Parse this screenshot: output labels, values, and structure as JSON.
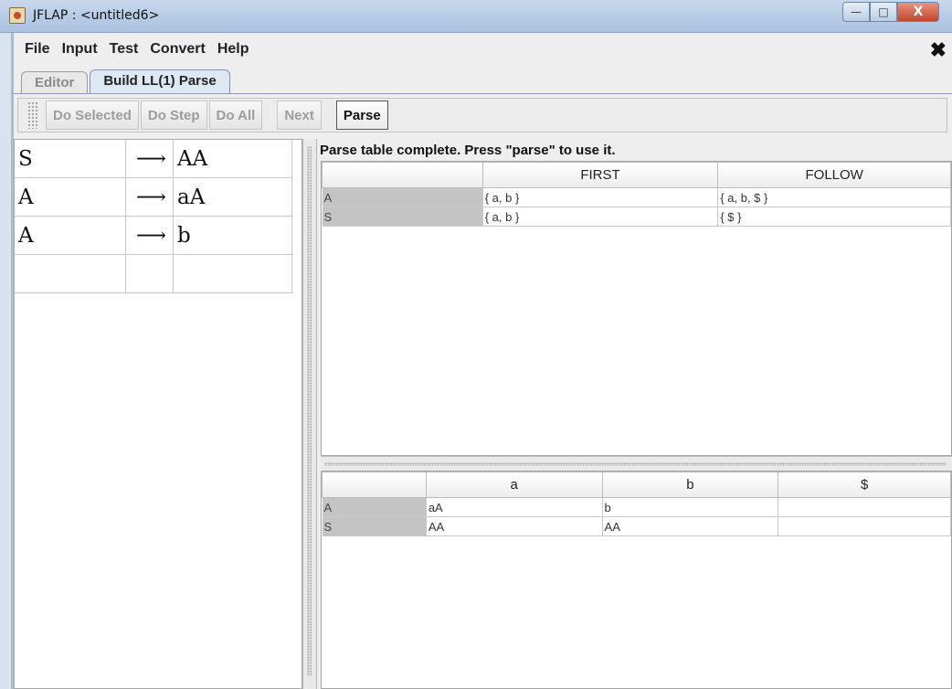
{
  "window": {
    "title": "JFLAP : <untitled6>",
    "controls": {
      "minimize": "—",
      "maximize": "□",
      "close": "X"
    }
  },
  "menu": {
    "items": [
      "File",
      "Input",
      "Test",
      "Convert",
      "Help"
    ],
    "close_glyph": "✖"
  },
  "tabs": [
    {
      "label": "Editor",
      "active": false
    },
    {
      "label": "Build LL(1) Parse",
      "active": true
    }
  ],
  "toolbar": {
    "do_selected": "Do Selected",
    "do_step": "Do Step",
    "do_all": "Do All",
    "next": "Next",
    "parse": "Parse"
  },
  "grammar": {
    "arrow": "⟶",
    "productions": [
      {
        "lhs": "S",
        "rhs": "AA"
      },
      {
        "lhs": "A",
        "rhs": "aA"
      },
      {
        "lhs": "A",
        "rhs": "b"
      },
      {
        "lhs": "",
        "rhs": ""
      }
    ]
  },
  "status_message": "Parse table complete.  Press \"parse\" to use it.",
  "first_follow": {
    "columns": [
      "",
      "FIRST",
      "FOLLOW"
    ],
    "rows": [
      {
        "symbol": "A",
        "first": "{ a, b }",
        "follow": "{ a, b, $ }"
      },
      {
        "symbol": "S",
        "first": "{ a, b }",
        "follow": "{ $ }"
      }
    ]
  },
  "parse_table": {
    "columns": [
      "",
      "a",
      "b",
      "$"
    ],
    "rows": [
      {
        "symbol": "A",
        "cells": [
          "aA",
          "b",
          ""
        ]
      },
      {
        "symbol": "S",
        "cells": [
          "AA",
          "AA",
          ""
        ]
      }
    ]
  }
}
